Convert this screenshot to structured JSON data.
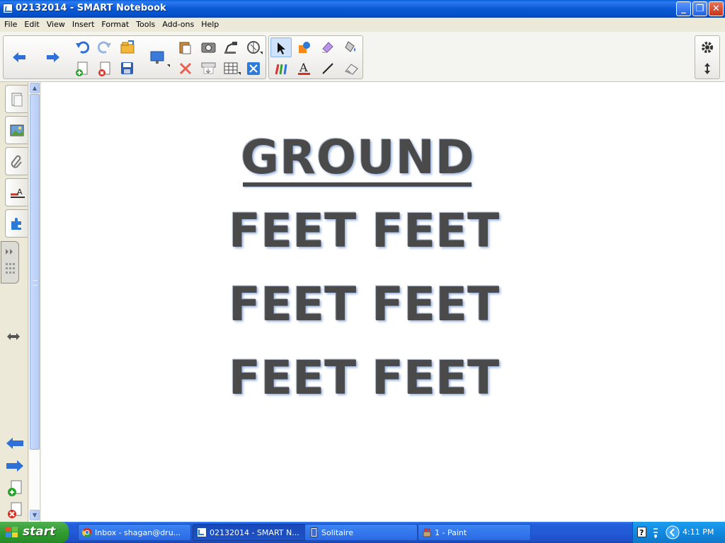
{
  "window": {
    "title": "02132014 - SMART Notebook"
  },
  "menu": [
    "File",
    "Edit",
    "View",
    "Insert",
    "Format",
    "Tools",
    "Add-ons",
    "Help"
  ],
  "toolbar": {
    "buttons": [
      "back-icon",
      "forward-icon",
      "undo-icon",
      "redo-icon",
      "open-icon",
      "add-page-icon",
      "delete-page-icon",
      "save-icon",
      "screen-icon",
      "paste-icon",
      "delete-icon",
      "screen-shade-icon",
      "table-icon",
      "capture-icon",
      "document-camera-icon",
      "measurement-tools-icon",
      "full-screen-icon",
      "select-icon",
      "shapes-icon",
      "creative-pens-icon",
      "pens-icon",
      "text-icon",
      "lines-icon",
      "eraser-icon",
      "fill-icon",
      "settings-icon",
      "move-toolbar-icon"
    ]
  },
  "canvas": {
    "heading": "GROUND",
    "words": [
      "FEET",
      "FEET",
      "FEET",
      "FEET",
      "FEET",
      "FEET"
    ]
  },
  "taskbar": {
    "start_label": "start",
    "tasks": [
      {
        "label": "Inbox - shagan@dru...",
        "active": false
      },
      {
        "label": "02132014 - SMART N...",
        "active": true
      },
      {
        "label": "Solitaire",
        "active": false
      },
      {
        "label": "1 - Paint",
        "active": false
      }
    ],
    "clock": "4:11 PM"
  },
  "colors": {
    "title_bar": "#0a58d4",
    "canvas_bg": "#ffffff",
    "text_main": "#4a4a4a",
    "taskbar": "#245edb",
    "start_green": "#2f9a2f"
  }
}
